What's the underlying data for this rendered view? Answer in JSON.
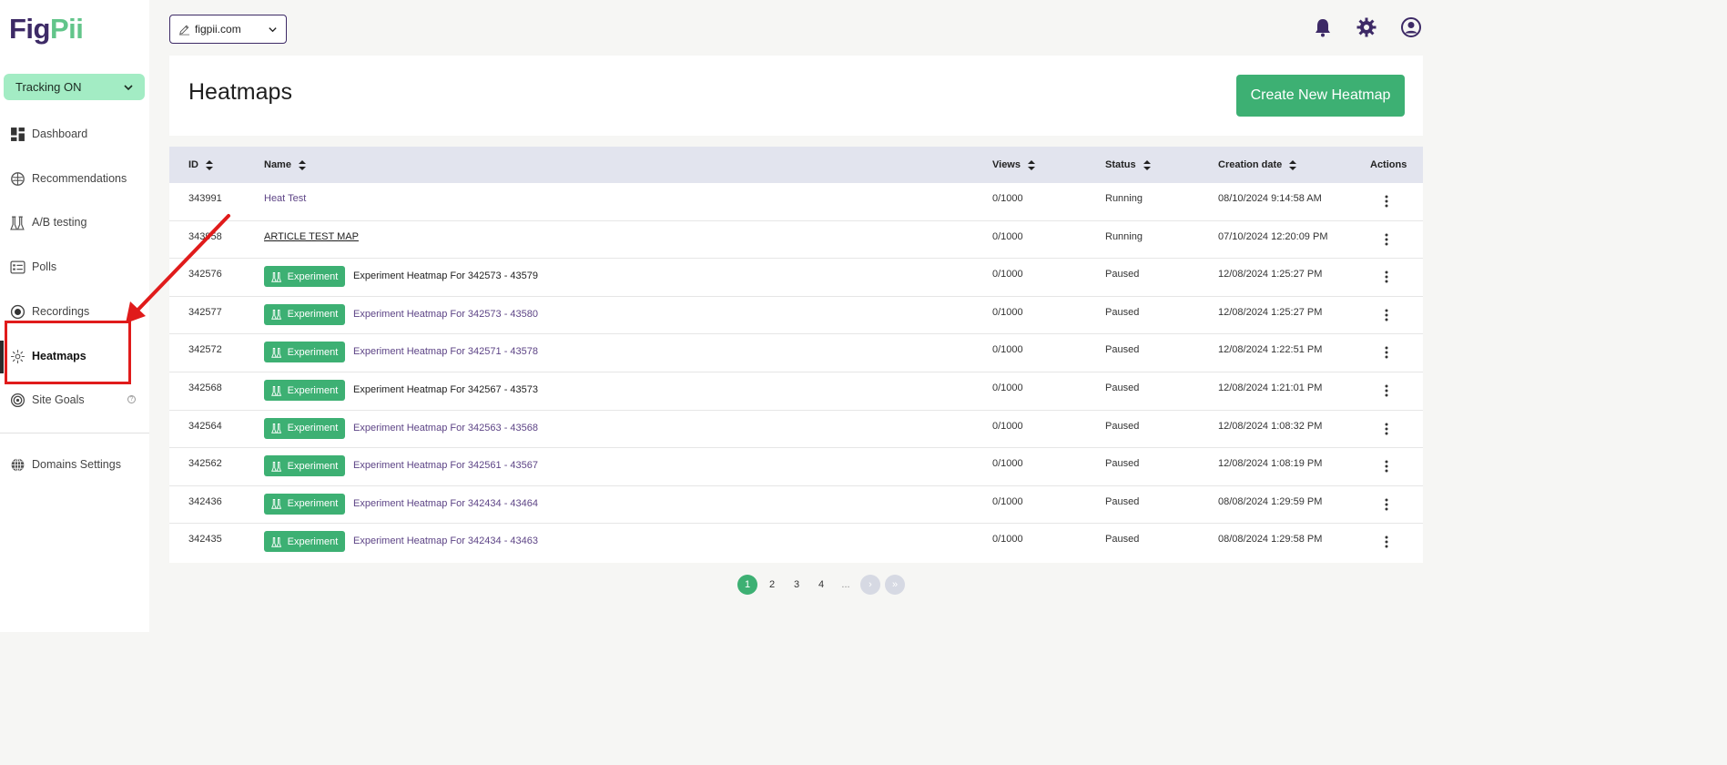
{
  "brand": {
    "logo_part1": "Fig",
    "logo_part2": "Pii"
  },
  "tracking": {
    "label": "Tracking ON"
  },
  "sidebar": {
    "items": [
      {
        "label": "Dashboard",
        "icon": "dashboard-icon"
      },
      {
        "label": "Recommendations",
        "icon": "brain-icon"
      },
      {
        "label": "A/B testing",
        "icon": "flask-icon"
      },
      {
        "label": "Polls",
        "icon": "poll-icon"
      },
      {
        "label": "Recordings",
        "icon": "record-icon"
      },
      {
        "label": "Heatmaps",
        "icon": "heatmap-icon",
        "active": true
      },
      {
        "label": "Site Goals",
        "icon": "target-icon"
      },
      {
        "label": "Domains Settings",
        "icon": "globe-icon"
      }
    ],
    "help_glyph": "?"
  },
  "topbar": {
    "domain": "figpii.com",
    "icons": [
      "bell-icon",
      "gear-icon",
      "user-icon"
    ]
  },
  "header": {
    "title": "Heatmaps",
    "create_button": "Create New Heatmap"
  },
  "table": {
    "columns": {
      "id": "ID",
      "name": "Name",
      "views": "Views",
      "status": "Status",
      "created": "Creation date",
      "actions": "Actions"
    },
    "badge_label": "Experiment",
    "rows": [
      {
        "id": "343991",
        "name": "Heat Test",
        "views": "0/1000",
        "status": "Running",
        "created": "08/10/2024 9:14:58 AM"
      },
      {
        "id": "343958",
        "name": "ARTICLE TEST MAP",
        "views": "0/1000",
        "status": "Running",
        "created": "07/10/2024 12:20:09 PM"
      },
      {
        "id": "342576",
        "name": "Experiment Heatmap For 342573 - 43579",
        "views": "0/1000",
        "status": "Paused",
        "created": "12/08/2024 1:25:27 PM"
      },
      {
        "id": "342577",
        "name": "Experiment Heatmap For 342573 - 43580",
        "views": "0/1000",
        "status": "Paused",
        "created": "12/08/2024 1:25:27 PM"
      },
      {
        "id": "342572",
        "name": "Experiment Heatmap For 342571 - 43578",
        "views": "0/1000",
        "status": "Paused",
        "created": "12/08/2024 1:22:51 PM"
      },
      {
        "id": "342568",
        "name": "Experiment Heatmap For 342567 - 43573",
        "views": "0/1000",
        "status": "Paused",
        "created": "12/08/2024 1:21:01 PM"
      },
      {
        "id": "342564",
        "name": "Experiment Heatmap For 342563 - 43568",
        "views": "0/1000",
        "status": "Paused",
        "created": "12/08/2024 1:08:32 PM"
      },
      {
        "id": "342562",
        "name": "Experiment Heatmap For 342561 - 43567",
        "views": "0/1000",
        "status": "Paused",
        "created": "12/08/2024 1:08:19 PM"
      },
      {
        "id": "342436",
        "name": "Experiment Heatmap For 342434 - 43464",
        "views": "0/1000",
        "status": "Paused",
        "created": "08/08/2024 1:29:59 PM"
      },
      {
        "id": "342435",
        "name": "Experiment Heatmap For 342434 - 43463",
        "views": "0/1000",
        "status": "Paused",
        "created": "08/08/2024 1:29:58 PM"
      }
    ]
  },
  "pagination": {
    "pages": [
      "1",
      "2",
      "3",
      "4"
    ],
    "ellipsis": "...",
    "current": "1",
    "next_glyph": "›",
    "last_glyph": "»"
  },
  "colors": {
    "brand_purple": "#3d2a66",
    "brand_green": "#62c58a",
    "primary_button": "#3db073",
    "tracking_bg": "#a3ecc4",
    "annotation_red": "#e01b1b"
  }
}
